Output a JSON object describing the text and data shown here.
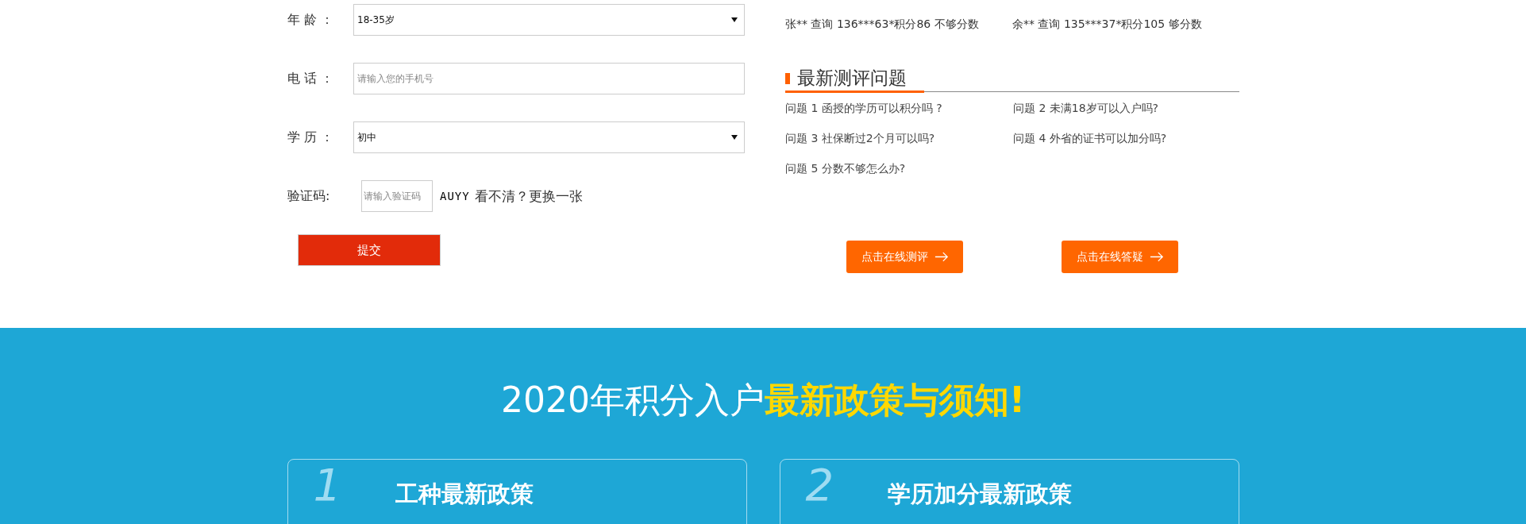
{
  "form": {
    "fields": [
      {
        "kind": "select",
        "label": "年 龄 ：",
        "value": "18-35岁"
      },
      {
        "kind": "text",
        "label": "电 话 ：",
        "placeholder": "请输入您的手机号"
      },
      {
        "kind": "select",
        "label": "学 历 ：",
        "value": "初中"
      }
    ],
    "captcha": {
      "label": "验证码:",
      "placeholder": "请输入验证码",
      "code": "AUYY",
      "refresh": "看不清？更换一张"
    },
    "submit": "提交"
  },
  "records": [
    "张** 查询 136***63*积分86 不够分数",
    "余** 查询 135***37*积分105 够分数"
  ],
  "questions": {
    "title": "最新测评问题",
    "items": [
      "问题 1 函授的学历可以积分吗 ?",
      "问题 2 未满18岁可以入户吗?",
      "问题 3 社保断过2个月可以吗?",
      "问题 4 外省的证书可以加分吗?",
      "问题 5 分数不够怎么办?"
    ]
  },
  "actions": [
    "点击在线测评",
    "点击在线答疑"
  ],
  "policy": {
    "title": "2020年积分入户**最新政策与须知!**",
    "cards": [
      {
        "number": "1",
        "title": "工种最新政策"
      },
      {
        "number": "2",
        "title": "学历加分最新政策"
      }
    ]
  }
}
